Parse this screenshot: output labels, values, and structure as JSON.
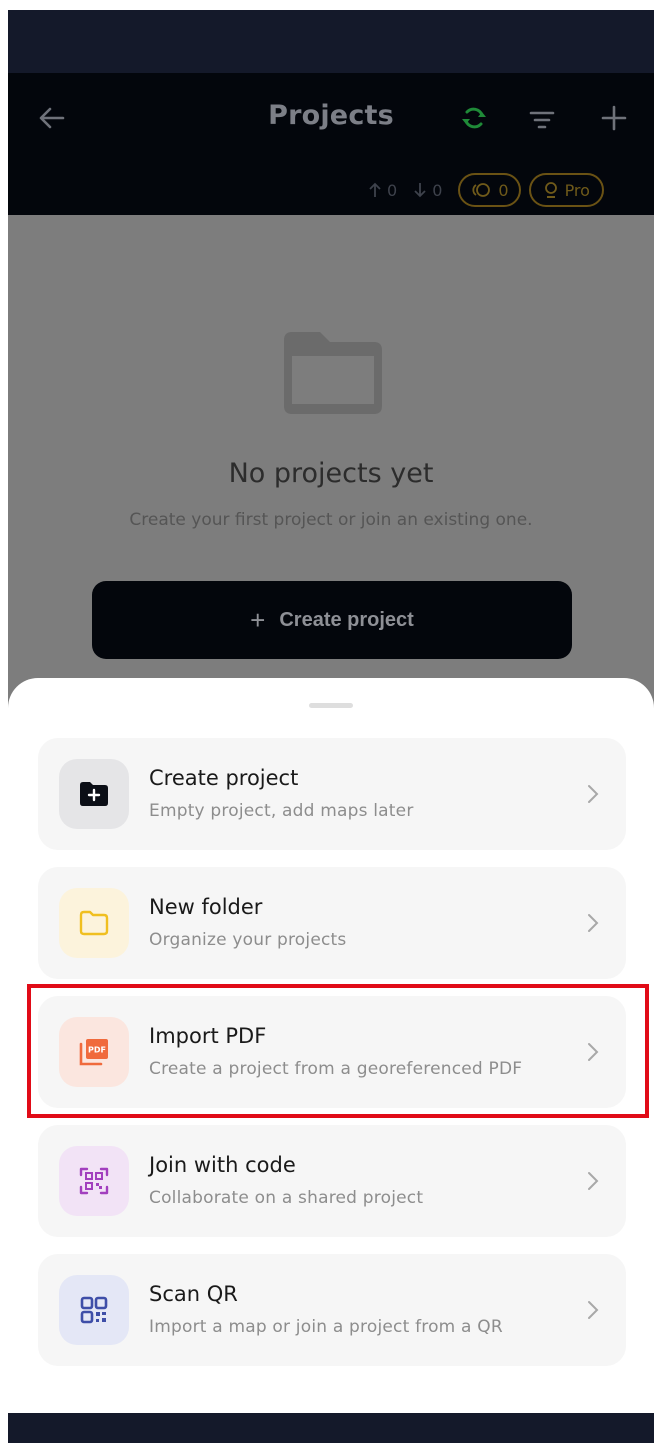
{
  "header": {
    "title": "Projects",
    "uploads": "0",
    "downloads": "0",
    "coins": "0",
    "pro_label": "Pro"
  },
  "empty_state": {
    "title": "No projects yet",
    "subtitle": "Create your first project or join an existing one.",
    "create_button": "Create project",
    "create_plus": "+"
  },
  "sheet": {
    "items": [
      {
        "title": "Create project",
        "subtitle": "Empty project, add maps later",
        "icon": "folder-plus-icon",
        "icon_bg": "#e5e5e7"
      },
      {
        "title": "New folder",
        "subtitle": "Organize your projects",
        "icon": "folder-icon",
        "icon_bg": "#fcf3dc"
      },
      {
        "title": "Import PDF",
        "subtitle": "Create a project from a georeferenced PDF",
        "icon": "pdf-icon",
        "icon_bg": "#fbe6df"
      },
      {
        "title": "Join with code",
        "subtitle": "Collaborate on a shared project",
        "icon": "code-scan-icon",
        "icon_bg": "#f2e3f6"
      },
      {
        "title": "Scan QR",
        "subtitle": "Import a map or join a project from a QR",
        "icon": "qr-code-icon",
        "icon_bg": "#e4e7f6"
      }
    ]
  },
  "colors": {
    "highlight": "#e10b17",
    "sync": "#1f8a38",
    "gold": "#6f5a1a"
  }
}
